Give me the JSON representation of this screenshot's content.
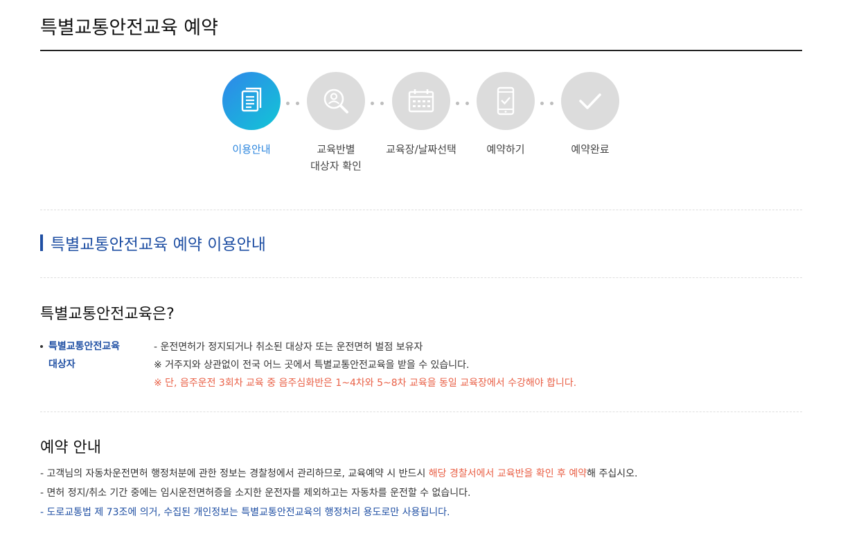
{
  "header": {
    "title": "특별교통안전교육 예약"
  },
  "steps": [
    {
      "label": "이용안내",
      "icon": "document-icon",
      "active": true
    },
    {
      "label": "교육반별\n대상자 확인",
      "icon": "search-person-icon",
      "active": false
    },
    {
      "label": "교육장/날짜선택",
      "icon": "calendar-icon",
      "active": false
    },
    {
      "label": "예약하기",
      "icon": "mobile-check-icon",
      "active": false
    },
    {
      "label": "예약완료",
      "icon": "checkmark-icon",
      "active": false
    }
  ],
  "section": {
    "title": "특별교통안전교육 예약 이용안내"
  },
  "about": {
    "heading": "특별교통안전교육은?",
    "target_label": "특별교통안전교육\n대상자",
    "lines": [
      "- 운전면허가 정지되거나 취소된 대상자 또는 운전면허 벌점 보유자",
      "※ 거주지와 상관없이 전국 어느 곳에서 특별교통안전교육을 받을 수 있습니다.",
      "※ 단, 음주운전 3회차 교육 중 음주심화반은 1~4차와 5~8차 교육을 동일 교육장에서 수강해야 합니다."
    ]
  },
  "reservation": {
    "heading": "예약 안내",
    "line1_pre": "- 고객님의 자동차운전면허 행정처분에 관한 정보는 경찰청에서 관리하므로, 교육예약 시 반드시 ",
    "line1_highlight": "해당 경찰서에서 교육반을 확인 후 예약",
    "line1_post": "해 주십시오.",
    "line2": "- 면허 정지/취소 기간 중에는 임시운전면허증을 소지한 운전자를 제외하고는 자동차를 운전할 수 없습니다.",
    "line3": "- 도로교통법 제 73조에 의거, 수집된 개인정보는 특별교통안전교육의 행정처리 용도로만 사용됩니다."
  },
  "colors": {
    "accent_blue": "#1f4fa3",
    "active_step": "#2c86de",
    "warning": "#e95f45",
    "inactive_step": "#dcdcdc"
  }
}
